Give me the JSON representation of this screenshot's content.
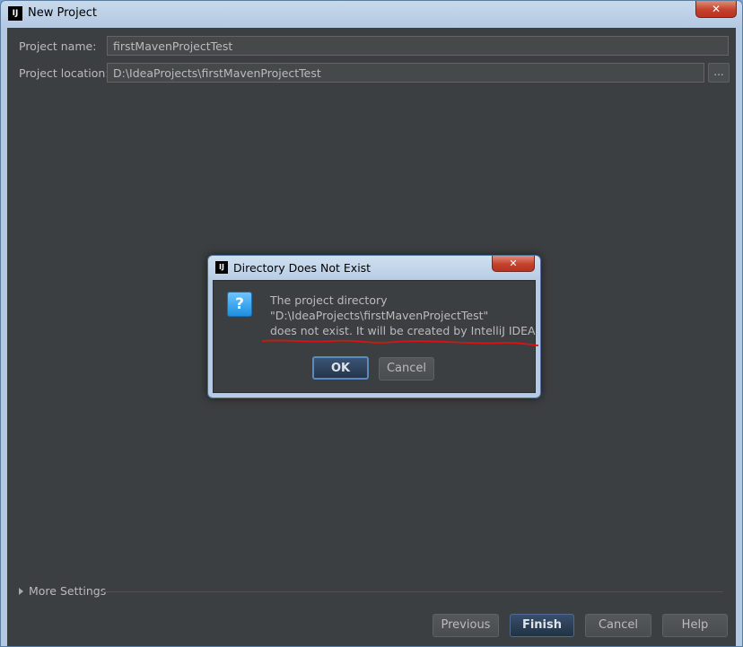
{
  "window": {
    "title": "New Project",
    "app_icon": "IJ",
    "close_symbol": "✕"
  },
  "form": {
    "project_name_label": "Project name:",
    "project_name_value": "firstMavenProjectTest",
    "project_location_label": "Project location:",
    "project_location_value": "D:\\IdeaProjects\\firstMavenProjectTest",
    "browse_label": "..."
  },
  "more_settings": "More Settings",
  "buttons": {
    "previous": "Previous",
    "finish": "Finish",
    "cancel": "Cancel",
    "help": "Help"
  },
  "dialog": {
    "title": "Directory Does Not Exist",
    "app_icon": "IJ",
    "close_symbol": "✕",
    "icon": "question-icon",
    "icon_glyph": "?",
    "message_line1": "The project directory",
    "message_line2": "\"D:\\IdeaProjects\\firstMavenProjectTest\"",
    "message_line3": "does not exist. It will be created by IntelliJ IDEA.",
    "ok": "OK",
    "cancel": "Cancel"
  },
  "colors": {
    "panel_bg": "#3c3f41",
    "annotation_red": "#e01010",
    "default_button": "#2c3e55"
  }
}
